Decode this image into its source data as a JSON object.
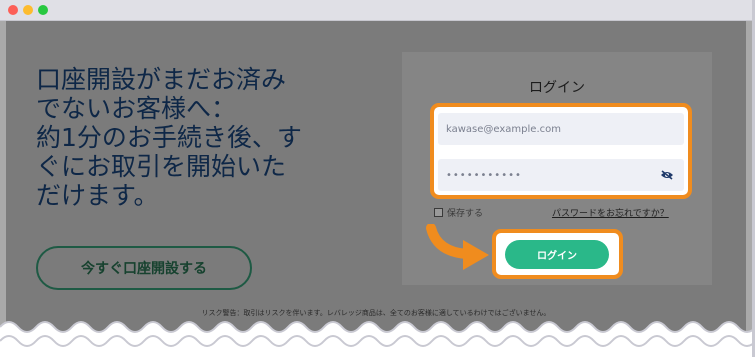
{
  "window": {
    "controls": [
      "close",
      "minimize",
      "maximize"
    ]
  },
  "signup": {
    "headline_lines": [
      "口座開設がまだお済み",
      "でないお客様へ：",
      "約1分のお手続き後、す",
      "ぐにお取引を開始いた",
      "だけます。"
    ],
    "cta_label": "今すぐ口座開設する"
  },
  "login": {
    "title": "ログイン",
    "email_value": "kawase@example.com",
    "password_value": "•••••••••••",
    "remember_label": "保存する",
    "forgot_link": "パスワードをお忘れですか？",
    "submit_label": "ログイン"
  },
  "footer": {
    "risk_warning": "リスク警告：取引はリスクを伴います。レバレッジ商品は、全てのお客様に適しているわけではございません。"
  },
  "colors": {
    "accent_orange": "#f08c1e",
    "button_green": "#2ab889",
    "headline_navy": "#0e2747"
  },
  "icons": {
    "password_toggle": "eye-slash-icon",
    "pointer": "curved-arrow-icon"
  }
}
